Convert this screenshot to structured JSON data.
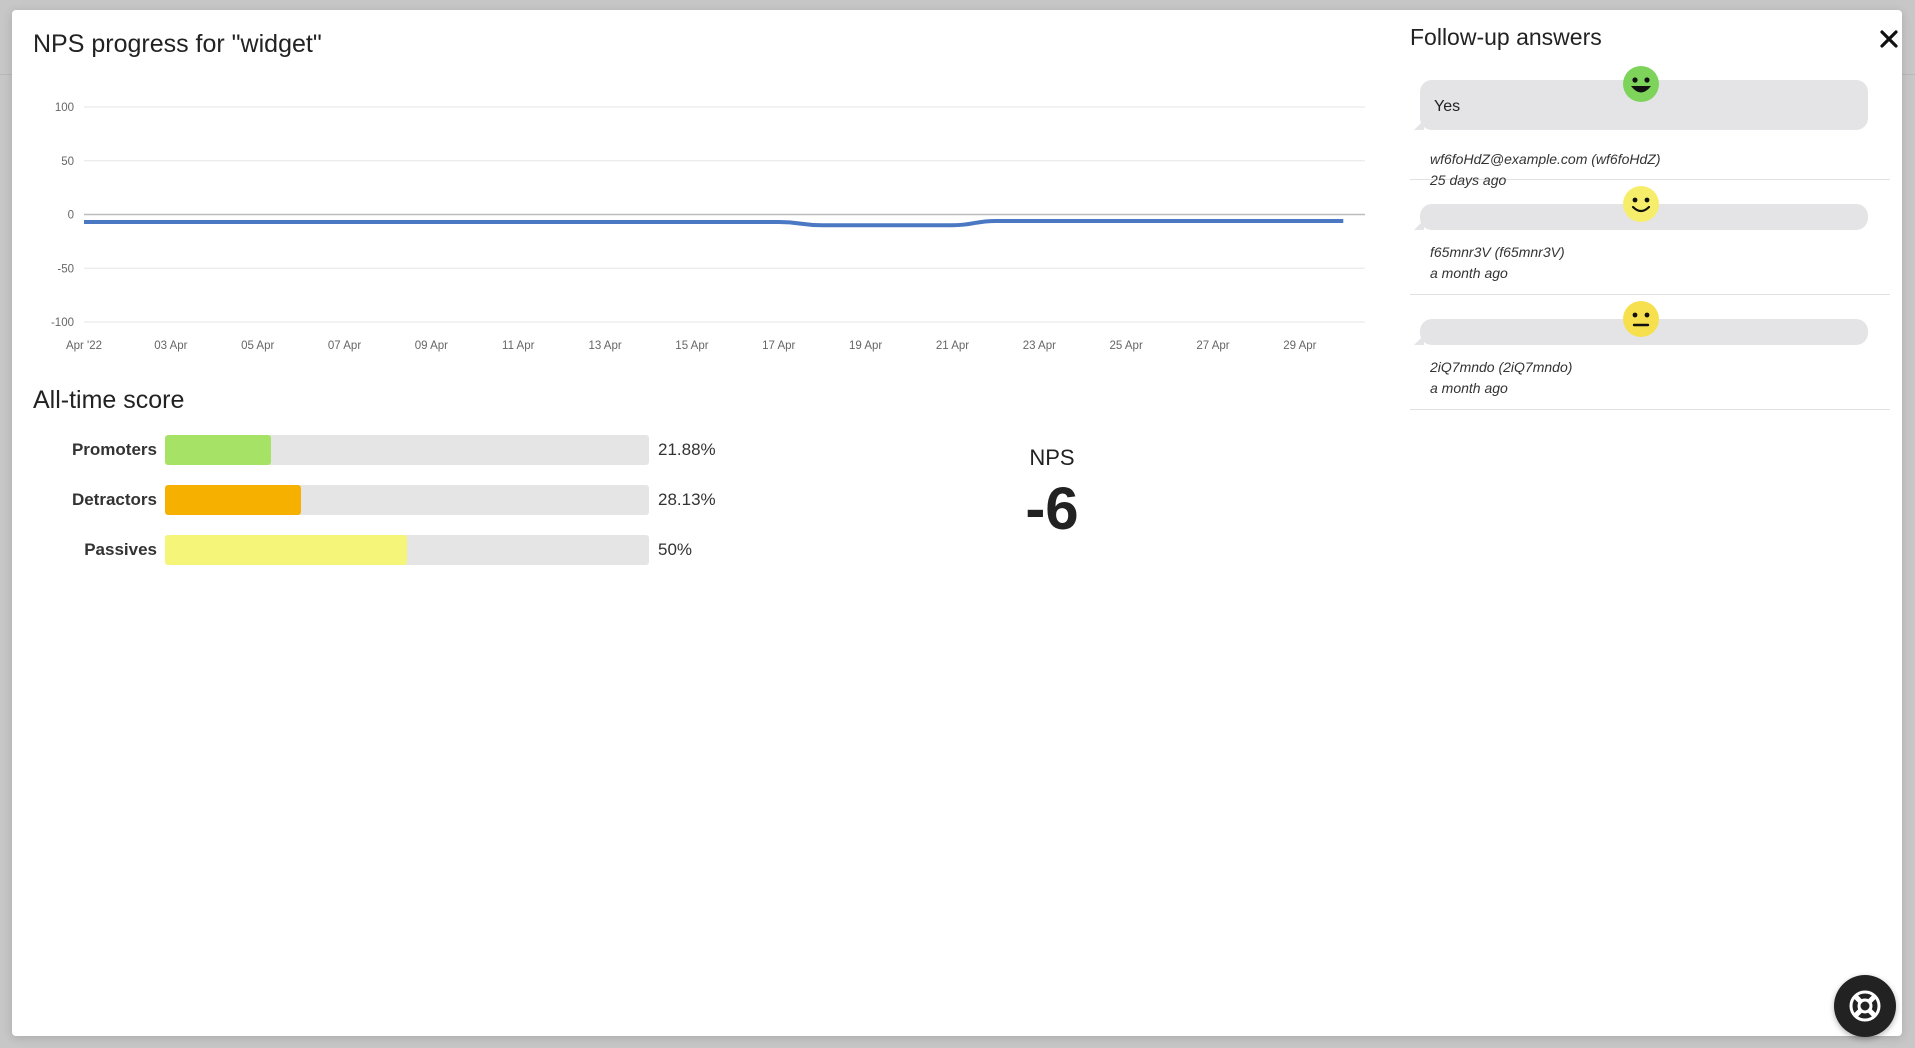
{
  "modal": {
    "title": "NPS progress for \"widget\"",
    "close_icon": "close-icon"
  },
  "chart_data": {
    "type": "line",
    "title": "",
    "xlabel": "",
    "ylabel": "",
    "ylim": [
      -100,
      100
    ],
    "y_ticks": [
      "100",
      "50",
      "0",
      "-50",
      "-100"
    ],
    "x_ticks": [
      "Apr '22",
      "03 Apr",
      "05 Apr",
      "07 Apr",
      "09 Apr",
      "11 Apr",
      "13 Apr",
      "15 Apr",
      "17 Apr",
      "19 Apr",
      "21 Apr",
      "23 Apr",
      "25 Apr",
      "27 Apr",
      "29 Apr"
    ],
    "grid": true,
    "series": [
      {
        "color": "#4a78c2",
        "x": [
          "Apr '22",
          "03 Apr",
          "05 Apr",
          "07 Apr",
          "09 Apr",
          "11 Apr",
          "13 Apr",
          "15 Apr",
          "17 Apr",
          "18 Apr",
          "19 Apr",
          "21 Apr",
          "22 Apr",
          "23 Apr",
          "25 Apr",
          "27 Apr",
          "29 Apr",
          "30 Apr"
        ],
        "values": [
          -7,
          -7,
          -7,
          -7,
          -7,
          -7,
          -7,
          -7,
          -7,
          -10,
          -10,
          -10,
          -6,
          -6,
          -6,
          -6,
          -6,
          -6
        ]
      }
    ]
  },
  "all_time": {
    "title": "All-time score",
    "rows": [
      {
        "label": "Promoters",
        "value_text": "21.88%",
        "fraction": 0.2188,
        "color": "#a6e265"
      },
      {
        "label": "Detractors",
        "value_text": "28.13%",
        "fraction": 0.2813,
        "color": "#f6b100"
      },
      {
        "label": "Passives",
        "value_text": "50%",
        "fraction": 0.5,
        "color": "#f5f57a"
      }
    ],
    "nps_label": "NPS",
    "nps_value": "-6"
  },
  "follow_up": {
    "title": "Follow-up answers",
    "items": [
      {
        "face": "grinning-face-icon",
        "face_color": "#7ed35b",
        "answer": "Yes",
        "user": "wf6foHdZ@example.com (wf6foHdZ)",
        "time": "25 days ago"
      },
      {
        "face": "smiling-face-icon",
        "face_color": "#f6ee6a",
        "answer": "",
        "user": "f65mnr3V (f65mnr3V)",
        "time": "a month ago"
      },
      {
        "face": "neutral-face-icon",
        "face_color": "#f6e04e",
        "answer": "",
        "user": "2iQ7mndo (2iQ7mndo)",
        "time": "a month ago"
      }
    ]
  },
  "help_button": {
    "icon": "lifebuoy-icon"
  }
}
